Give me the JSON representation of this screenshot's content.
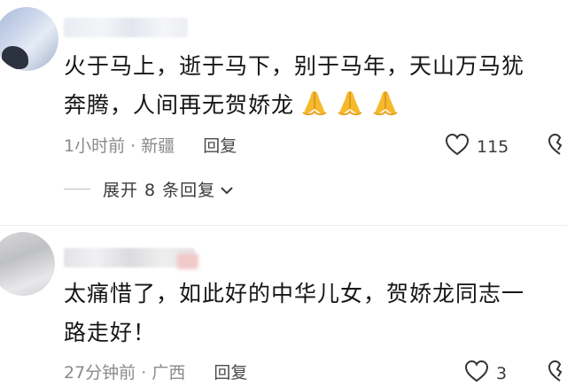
{
  "comments": [
    {
      "text_line1": "火于马上，逝于马下，别于马年，天山万马犹",
      "text_line2": "奔腾，人间再无贺娇龙",
      "emoji": [
        "folded-hands",
        "folded-hands",
        "folded-hands"
      ],
      "time": "1小时前",
      "location": "新疆",
      "reply_label": "回复",
      "likes": "115"
    },
    {
      "text_line1": "太痛惜了，如此好的中华儿女，贺娇龙同志一",
      "text_line2": "路走好！",
      "time": "27分钟前",
      "location": "广西",
      "reply_label": "回复",
      "likes": "3"
    }
  ],
  "expand_replies": "展开 8 条回复",
  "colors": {
    "meta_gray": "#8a8a8a",
    "emoji_yellow": "#f5b92b"
  }
}
